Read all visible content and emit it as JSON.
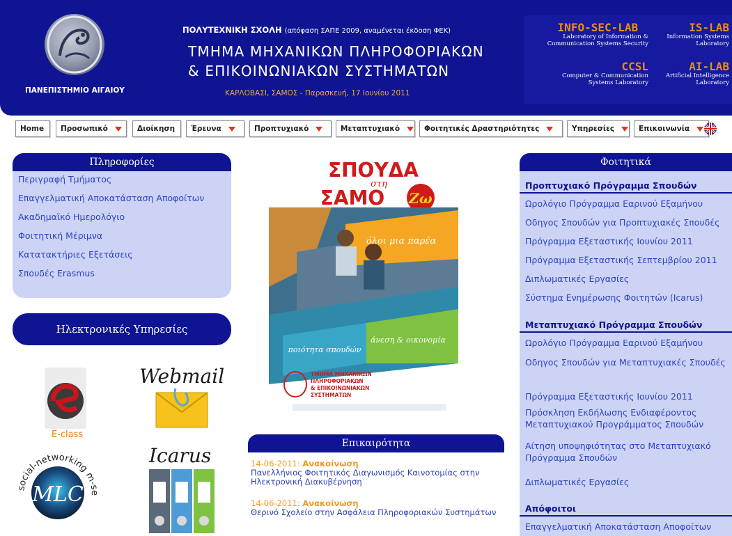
{
  "header": {
    "university": "ΠΑΝΕΠΙΣΤΗΜΙΟ ΑΙΓΑΙΟΥ",
    "school": "ΠΟΛΥΤΕΧΝΙΚΗ ΣΧΟΛΗ",
    "school_note": "(απόφαση ΣΑΠΕ 2009, αναμένεται έκδοση ΦΕΚ)",
    "dept_line1": "ΤΜΗΜΑ ΜΗΧΑΝΙΚΩΝ ΠΛΗΡΟΦΟΡΙΑΚΩΝ",
    "dept_line2": "& ΕΠΙΚΟΙΝΩΝΙΑΚΩΝ ΣΥΣΤΗΜΑΤΩΝ",
    "location_date": "ΚΑΡΛΟΒΑΣΙ, ΣΑΜΟΣ - Παρασκευή, 17 Ιουνίου 2011"
  },
  "labs": {
    "infosec": {
      "name": "INFO-SEC-LAB",
      "desc1": "Laboratory of Information &",
      "desc2": "Communication Systems Security"
    },
    "islab": {
      "name": "IS-LAB",
      "desc1": "Information Systems",
      "desc2": "Laboratory"
    },
    "ccsl": {
      "name": "CCSL",
      "desc1": "Computer & Communication",
      "desc2": "Systems Laboratory"
    },
    "ailab": {
      "name": "AI-LAB",
      "desc1": "Artificial Intelligence",
      "desc2": "Laboratory"
    }
  },
  "nav": [
    {
      "label": "Home"
    },
    {
      "label": "Προσωπικό"
    },
    {
      "label": "Διοίκηση"
    },
    {
      "label": "Έρευνα"
    },
    {
      "label": "Προπτυχιακό"
    },
    {
      "label": "Μεταπτυχιακό"
    },
    {
      "label": "Φοιτητικές Δραστηριότητες"
    },
    {
      "label": "Υπηρεσίες"
    },
    {
      "label": "Επικοινωνία"
    }
  ],
  "info_panel": {
    "title": "Πληροφορίες",
    "links": [
      "Περιγραφή Τμήματος",
      "Επαγγελματική Αποκατάσταση Αποφοίτων",
      "Ακαδημαϊκό Ημερολόγιο",
      "Φοιτητική Μέριμνα",
      "Κατατακτήριες Εξετάσεις",
      "Σπουδές Erasmus"
    ]
  },
  "eservices": {
    "title": "Ηλεκτρονικές Υπηρεσίες",
    "eclass": "E-class",
    "webmail": "Webmail",
    "icarus": "Icarus",
    "mlc": "MLC",
    "mlc_ring": "social-networking m-services"
  },
  "poster": {
    "title1": "ΣΠΟΥΔΑ",
    "title2": "στη",
    "title3": "ΣΑΜΟ",
    "title4": "Ζω",
    "banner1": "όλοι μια παρέα",
    "banner2": "ποιότητα σπουδών",
    "banner3": "άνεση & οικονομία",
    "dept1": "ΤΜΗΜΑ ΜΗΧΑΝΙΚΩΝ",
    "dept2": "ΠΛΗΡΟΦΟΡΙΑΚΩΝ",
    "dept3": "& ΕΠΙΚΟΙΝΩΝΙΑΚΩΝ",
    "dept4": "ΣΥΣΤΗΜΑΤΩΝ"
  },
  "news": {
    "title": "Επικαιρότητα",
    "items": [
      {
        "date": "14-06-2011:",
        "kind": "Ανακοίνωση",
        "text": "Πανελλήνιος Φοιτητικός Διαγωνισμός Καινοτομίας στην Ηλεκτρονική Διακυβέρνηση"
      },
      {
        "date": "14-06-2011:",
        "kind": "Ανακοίνωση",
        "text": "Θερινό Σχολείο στην Ασφάλεια Πληροφοριακών Συστημάτων"
      }
    ]
  },
  "students_panel": {
    "title": "Φοιτητικά",
    "sections": [
      {
        "title": "Προπτυχιακό Πρόγραμμα Σπουδών",
        "links": [
          "Ωρολόγιο Πρόγραμμα Εαρινού Εξαμήνου",
          "Οδηγος Σπουδών για Προπτυχιακές Σπουδές",
          "Πρόγραμμα Εξεταστικής Ιουνίου 2011",
          "Πρόγραμμα Εξεταστικής Σεπτεμβρίου 2011",
          "Διπλωματικές Εργασίες",
          "Σύστημα Ενημέρωσης Φοιτητών (Icarus)"
        ]
      },
      {
        "title": "Μεταπτυχιακό Πρόγραμμα Σπουδών",
        "links": [
          "Ωρολόγιο Πρόγραμμα Εαρινού Εξαμήνου",
          "Οδηγος Σπουδών για Μεταπτυχιακές Σπουδές",
          "Πρόγραμμα Εξεταστικής Ιουνίου 2011",
          "Πρόσκληση Εκδήλωσης Ενδιαφέροντος Μεταπτυχιακού Προγράμματος Σπουδών",
          "Αίτηση υποψηφιότητας στο Μεταπτυχιακό Πρόγραμμα Σπουδών",
          "Διπλωματικές Εργασίες"
        ]
      },
      {
        "title": "Απόφοιτοι",
        "links": [
          "Επαγγελματική Αποκατάσταση Αποφοίτων"
        ]
      }
    ]
  },
  "colors": {
    "brand_blue": "#0f1493",
    "panel_lavender": "#cdd3f4",
    "link_blue": "#2c44c4",
    "accent_orange": "#f29a1f",
    "nav_arrow_red": "#e0341c"
  }
}
